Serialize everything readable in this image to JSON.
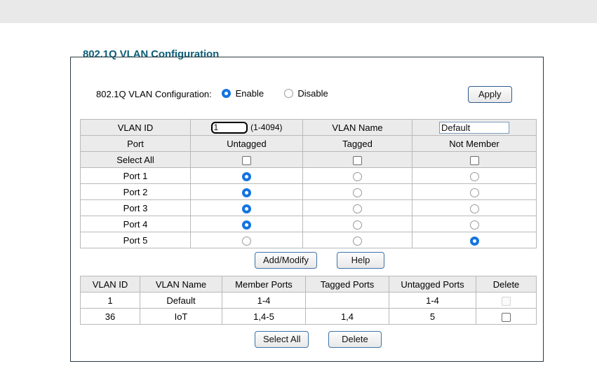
{
  "page": {
    "legend": "802.1Q VLAN Configuration"
  },
  "enable_row": {
    "label": "802.1Q VLAN Configuration:",
    "options": [
      {
        "label": "Enable",
        "selected": true
      },
      {
        "label": "Disable",
        "selected": false
      }
    ],
    "apply_label": "Apply"
  },
  "port_table": {
    "vlan_id_header": "VLAN ID",
    "vlan_id_value": "1",
    "vlan_id_range": "(1-4094)",
    "vlan_name_header": "VLAN Name",
    "vlan_name_value": "Default",
    "port_header": "Port",
    "untagged_header": "Untagged",
    "tagged_header": "Tagged",
    "not_member_header": "Not Member",
    "select_all_label": "Select All",
    "rows": [
      {
        "port": "Port 1",
        "membership": "untagged"
      },
      {
        "port": "Port 2",
        "membership": "untagged"
      },
      {
        "port": "Port 3",
        "membership": "untagged"
      },
      {
        "port": "Port 4",
        "membership": "untagged"
      },
      {
        "port": "Port 5",
        "membership": "not_member"
      }
    ]
  },
  "mid_buttons": {
    "add_modify": "Add/Modify",
    "help": "Help"
  },
  "list_table": {
    "headers": {
      "vlan_id": "VLAN ID",
      "vlan_name": "VLAN Name",
      "member_ports": "Member Ports",
      "tagged_ports": "Tagged Ports",
      "untagged_ports": "Untagged Ports",
      "delete": "Delete"
    },
    "rows": [
      {
        "vlan_id": "1",
        "vlan_name": "Default",
        "member_ports": "1-4",
        "tagged_ports": "",
        "untagged_ports": "1-4",
        "delete_enabled": false,
        "delete_checked": false
      },
      {
        "vlan_id": "36",
        "vlan_name": "IoT",
        "member_ports": "1,4-5",
        "tagged_ports": "1,4",
        "untagged_ports": "5",
        "delete_enabled": true,
        "delete_checked": false
      }
    ]
  },
  "bottom_buttons": {
    "select_all": "Select All",
    "delete": "Delete"
  },
  "colors": {
    "legend_text": "#0d5f78",
    "radio_accent": "#1474e0",
    "button_border": "#3f72a8",
    "header_bg": "#ebebeb",
    "top_bar": "#e9e9e9"
  }
}
